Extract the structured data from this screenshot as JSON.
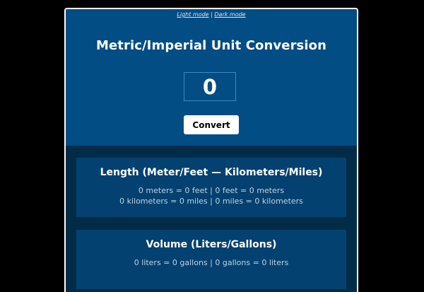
{
  "mode_links": {
    "light": "Light mode",
    "separator": "|",
    "dark": "Dark mode"
  },
  "header": {
    "title": "Metric/Imperial Unit Conversion"
  },
  "input": {
    "value": "0"
  },
  "convert_button": {
    "label": "Convert"
  },
  "results": [
    {
      "title": "Length (Meter/Feet — Kilometers/Miles)",
      "lines": [
        "0 meters = 0 feet | 0 feet = 0 meters",
        "0 kilometers = 0 miles | 0 miles = 0 kilometers"
      ]
    },
    {
      "title": "Volume (Liters/Gallons)",
      "lines": [
        "0 liters = 0 gallons | 0 gallons = 0 liters"
      ]
    }
  ],
  "colors": {
    "page_background": "#000000",
    "header_background": "#034d85",
    "results_background": "#022b48",
    "card_background": "#034170",
    "button_background": "#ffffff"
  }
}
